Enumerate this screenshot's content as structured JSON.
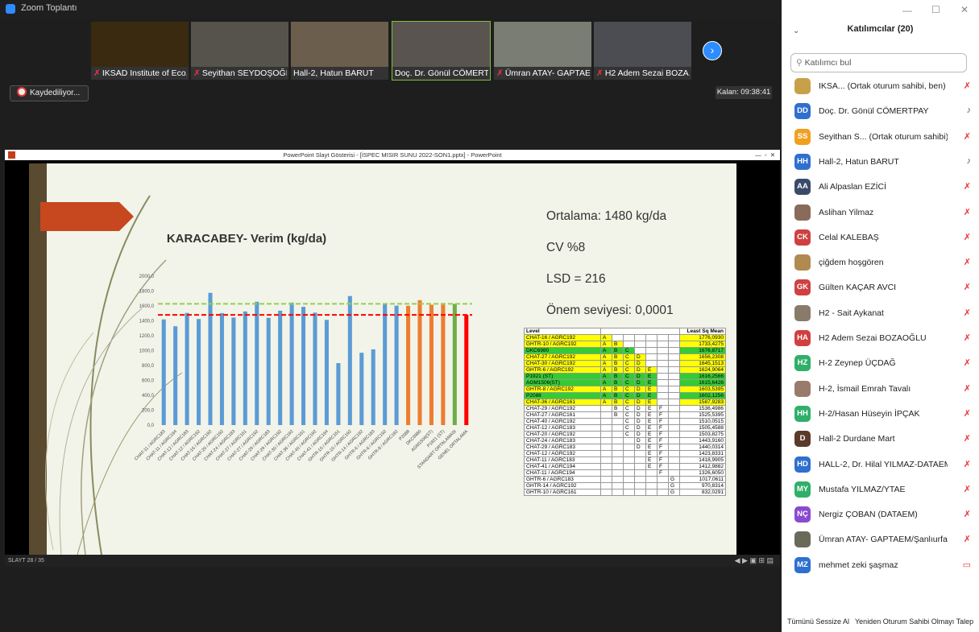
{
  "zoom": {
    "window_title": "Zoom Toplantı",
    "tiles": [
      {
        "name": "IKSAD Institute of Eco...",
        "muted": true,
        "bg": "#3a2a10"
      },
      {
        "name": "Seyithan SEYDOŞOĞLU",
        "muted": true,
        "bg": "#56534c"
      },
      {
        "name": "Hall-2, Hatun BARUT",
        "muted": false,
        "bg": "#6b5e4c"
      },
      {
        "name": "Doç. Dr. Gönül CÖMERT...",
        "muted": false,
        "bg": "#5a5450"
      },
      {
        "name": "Ümran ATAY- GAPTAE...",
        "muted": true,
        "bg": "#7a7d73"
      },
      {
        "name": "H2 Adem Sezai BOZA...",
        "muted": true,
        "bg": "#4b4d52"
      }
    ],
    "recording_label": "Kaydediliyor...",
    "remaining": "Kalan: 09:38:41"
  },
  "ppt": {
    "title_bar": "PowerPoint Slayt Gösterisi - [İSPEC MISIR SUNU 2022-SON1.pptx] - PowerPoint",
    "slide_counter": "SLAYT 28 / 35"
  },
  "slide": {
    "stats": [
      "Ortalama: 1480 kg/da",
      "CV %8",
      "LSD = 216",
      "Önem seviyesi: 0,0001"
    ],
    "table_header_level": "Level",
    "table_header_mean": "Least Sq Mean",
    "table_rows": [
      {
        "level": "CHAT-16 / AGRC192",
        "letters": "A",
        "mean": "1776,0930",
        "hl": "#ffff00"
      },
      {
        "level": "GHTR-10 / AGRC192",
        "letters": "AB",
        "mean": "1733,4275",
        "hl": "#ffff00"
      },
      {
        "level": "DKC6980",
        "letters": "ABC",
        "mean": "1676,8717",
        "hl": "#33cc33"
      },
      {
        "level": "CHAT-27 / AGRC192",
        "letters": "ABCD",
        "mean": "1656,2308",
        "hl": "#ffff00"
      },
      {
        "level": "CHAT-30 / AGRC192",
        "letters": "ABCD",
        "mean": "1645,1513",
        "hl": "#ffff00"
      },
      {
        "level": "GHTR-6 / AGRC192",
        "letters": "ABCDE",
        "mean": "1624,9064",
        "hl": "#ffff00"
      },
      {
        "level": "P1921 (ST)",
        "letters": "ABCDE",
        "mean": "1616,2566",
        "hl": "#33cc33"
      },
      {
        "level": "AGM1506(ST)",
        "letters": "ABCDE",
        "mean": "1615,6426",
        "hl": "#33cc33"
      },
      {
        "level": "GHTR-8 / AGRC192",
        "letters": "ABCDE",
        "mean": "1603,5395",
        "hl": "#ffff00"
      },
      {
        "level": "P2088",
        "letters": "ABCDE",
        "mean": "1602,1256",
        "hl": "#33cc33"
      },
      {
        "level": "CHAT-36 / AGRC161",
        "letters": "ABCDE",
        "mean": "1587,9283",
        "hl": "#ffff00"
      },
      {
        "level": "CHAT-29 / AGRC192",
        "letters": "BCDEF",
        "mean": "1536,4986",
        "hl": ""
      },
      {
        "level": "CHAT-27 / AGRC161",
        "letters": "BCDEF",
        "mean": "1525,5395",
        "hl": ""
      },
      {
        "level": "CHAT-40 / AGRC192",
        "letters": "CDEF",
        "mean": "1510,0515",
        "hl": ""
      },
      {
        "level": "CHAT-12 / AGRC183",
        "letters": "CDEF",
        "mean": "1505,4588",
        "hl": ""
      },
      {
        "level": "CHAT-20 / AGRC192",
        "letters": "CDEF",
        "mean": "1503,8275",
        "hl": ""
      },
      {
        "level": "CHAT-24 / AGRC183",
        "letters": "DEF",
        "mean": "1443,9160",
        "hl": ""
      },
      {
        "level": "CHAT-29 / AGRC183",
        "letters": "DEF",
        "mean": "1440,0314",
        "hl": ""
      },
      {
        "level": "CHAT-12 / AGRC192",
        "letters": "EF",
        "mean": "1423,8331",
        "hl": ""
      },
      {
        "level": "CHAT-11 / AGRC183",
        "letters": "EF",
        "mean": "1418,9905",
        "hl": ""
      },
      {
        "level": "CHAT-41 / AGRC194",
        "letters": "EF",
        "mean": "1412,9882",
        "hl": ""
      },
      {
        "level": "CHAT-11 / AGRC194",
        "letters": "F",
        "mean": "1326,6050",
        "hl": ""
      },
      {
        "level": "GHTR-6 / AGRC183",
        "letters": "G",
        "mean": "1017,0611",
        "hl": ""
      },
      {
        "level": "GHTR-14 / AGRC192",
        "letters": "G",
        "mean": "970,8314",
        "hl": ""
      },
      {
        "level": "GHTR-10 / AGRC161",
        "letters": "G",
        "mean": "832,0291",
        "hl": ""
      }
    ]
  },
  "chart_data": {
    "type": "bar",
    "title": "KARACABEY- Verim (kg/da)",
    "ylim": [
      0,
      2000
    ],
    "yticks": [
      "2000,0",
      "1800,0",
      "1600,0",
      "1400,0",
      "1200,0",
      "1000,0",
      "800,0",
      "600,0",
      "400,0",
      "200,0",
      "0,0"
    ],
    "categories": [
      "CHAT-11 / AGRC183",
      "CHAT-11 / AGRC194",
      "CHAT-12 / AGRC183",
      "CHAT-12 / AGRC192",
      "CHAT-16 / AGRC192",
      "CHAT-20 / AGRC192",
      "CHAT-24 / AGRC183",
      "CHAT-27 / AGRC161",
      "CHAT-27 / AGRC192",
      "CHAT-29 / AGRC183",
      "CHAT-29 / AGRC192",
      "CHAT-30 / AGRC192",
      "CHAT-36 / AGRC161",
      "CHAT-40 / AGRC192",
      "CHAT-41 / AGRC194",
      "GHTR-10 / AGRC161",
      "GHTR-10 / AGRC192",
      "GHTR-14 / AGRC192",
      "GHTR-6 / AGRC183",
      "GHTR-6 / AGRC192",
      "GHTR-8 / AGRC192",
      "P2088",
      "DKC6980",
      "AGM1506(ST)",
      "P1921 (ST)",
      "STANDART ORTALAMASI",
      "GENEL ORTALAMA"
    ],
    "values": [
      1419,
      1327,
      1506,
      1424,
      1776,
      1504,
      1444,
      1526,
      1656,
      1440,
      1536,
      1645,
      1588,
      1510,
      1413,
      832,
      1733,
      971,
      1017,
      1625,
      1604,
      1602,
      1677,
      1616,
      1616,
      1628,
      1480
    ],
    "colors": [
      "#5b9bd5",
      "#5b9bd5",
      "#5b9bd5",
      "#5b9bd5",
      "#5b9bd5",
      "#5b9bd5",
      "#5b9bd5",
      "#5b9bd5",
      "#5b9bd5",
      "#5b9bd5",
      "#5b9bd5",
      "#5b9bd5",
      "#5b9bd5",
      "#5b9bd5",
      "#5b9bd5",
      "#5b9bd5",
      "#5b9bd5",
      "#5b9bd5",
      "#5b9bd5",
      "#5b9bd5",
      "#5b9bd5",
      "#ed7d31",
      "#ed7d31",
      "#ed7d31",
      "#ed7d31",
      "#70ad47",
      "#ff0000"
    ],
    "reference_lines": [
      1628,
      1480
    ],
    "reference_colors": [
      "#92d050",
      "#ff0000"
    ]
  },
  "participants": {
    "title": "Katılımcılar (20)",
    "search_placeholder": "Katılımcı bul",
    "list": [
      {
        "initials": "",
        "name": "IKSA... (Ortak oturum sahibi, ben)",
        "color": "#c9a04a",
        "mic": "muted"
      },
      {
        "initials": "DD",
        "name": "Doç. Dr. Gönül CÖMERTPAY",
        "color": "#2f6fcf",
        "mic": "on"
      },
      {
        "initials": "SS",
        "name": "Seyithan S... (Ortak oturum sahibi)",
        "color": "#f0a020",
        "mic": "muted"
      },
      {
        "initials": "HH",
        "name": "Hall-2, Hatun BARUT",
        "color": "#2f6fcf",
        "mic": "on"
      },
      {
        "initials": "AA",
        "name": "Ali Alpaslan EZİCİ",
        "color": "#3a4a6a",
        "mic": "muted"
      },
      {
        "initials": "",
        "name": "Aslihan Yilmaz",
        "color": "#8a6a5a",
        "mic": "muted"
      },
      {
        "initials": "CK",
        "name": "Celal KALEBAŞ",
        "color": "#d04040",
        "mic": "muted"
      },
      {
        "initials": "",
        "name": "çiğdem hoşgören",
        "color": "#b08a50",
        "mic": "muted"
      },
      {
        "initials": "GK",
        "name": "Gülten KAÇAR AVCI",
        "color": "#d04040",
        "mic": "muted"
      },
      {
        "initials": "",
        "name": "H2 - Sait Aykanat",
        "color": "#8a7a6a",
        "mic": "muted"
      },
      {
        "initials": "HA",
        "name": "H2 Adem Sezai BOZAOĞLU",
        "color": "#d04040",
        "mic": "muted"
      },
      {
        "initials": "HZ",
        "name": "H-2 Zeynep ÜÇDAĞ",
        "color": "#2faf6a",
        "mic": "muted"
      },
      {
        "initials": "",
        "name": "H-2, İsmail Emrah Tavalı",
        "color": "#9a7a6a",
        "mic": "muted"
      },
      {
        "initials": "HH",
        "name": "H-2/Hasan Hüseyin İPÇAK",
        "color": "#2faf6a",
        "mic": "muted"
      },
      {
        "initials": "D",
        "name": "Hall-2 Durdane Mart",
        "color": "#5a3a2a",
        "mic": "muted"
      },
      {
        "initials": "HD",
        "name": "HALL-2, Dr. Hilal YILMAZ-DATAEM",
        "color": "#2f6fcf",
        "mic": "muted"
      },
      {
        "initials": "MY",
        "name": "Mustafa YILMAZ/YTAE",
        "color": "#2faf6a",
        "mic": "muted"
      },
      {
        "initials": "NÇ",
        "name": "Nergiz ÇOBAN (DATAEM)",
        "color": "#8a4ad0",
        "mic": "muted"
      },
      {
        "initials": "",
        "name": "Ümran ATAY- GAPTAEM/Şanlıurfa",
        "color": "#6a6a5a",
        "mic": "muted"
      },
      {
        "initials": "MZ",
        "name": "mehmet zeki şaşmaz",
        "color": "#2f6fcf",
        "mic": "none"
      }
    ],
    "mute_all": "Tümünü Sessize Al",
    "reclaim_host": "Yeniden Oturum Sahibi Olmayı Talep"
  }
}
